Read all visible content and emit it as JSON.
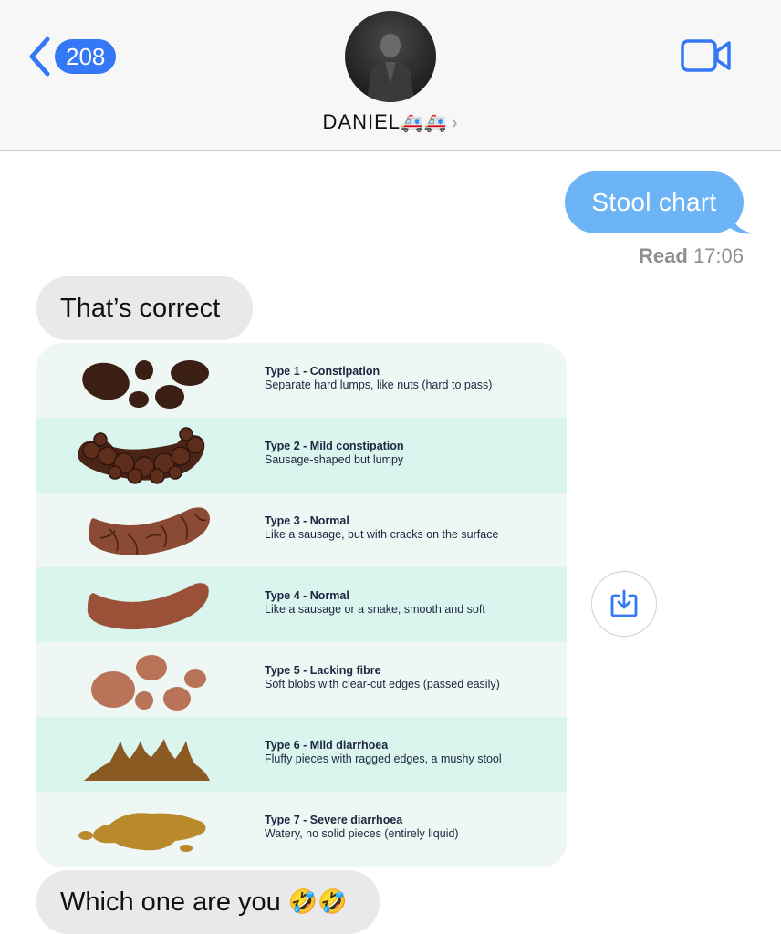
{
  "header": {
    "unread_count": "208",
    "contact_name": "DANIEL",
    "contact_emoji": "🚑🚑",
    "chevron": "›"
  },
  "messages": {
    "outgoing_1": "Stool chart",
    "read_label": "Read",
    "read_time": "17:06",
    "incoming_1": "That’s correct",
    "incoming_2": "Which one are you",
    "incoming_2_emoji": "🤣🤣"
  },
  "stool_chart": {
    "rows": [
      {
        "title": "Type 1 - Constipation",
        "desc": "Separate hard lumps, like nuts (hard to pass)"
      },
      {
        "title": "Type 2 - Mild constipation",
        "desc": "Sausage-shaped but lumpy"
      },
      {
        "title": "Type 3 - Normal",
        "desc": "Like a sausage, but with cracks on the surface"
      },
      {
        "title": "Type 4 - Normal",
        "desc": "Like a sausage or a snake, smooth and soft"
      },
      {
        "title": "Type 5 - Lacking fibre",
        "desc": "Soft blobs with clear-cut edges (passed easily)"
      },
      {
        "title": "Type 6 - Mild diarrhoea",
        "desc": "Fluffy pieces with ragged edges, a mushy stool"
      },
      {
        "title": "Type 7 - Severe diarrhoea",
        "desc": "Watery, no solid pieces (entirely liquid)"
      }
    ]
  },
  "colors": {
    "ios_blue": "#3478f6",
    "outgoing_bubble": "#6cb4f5",
    "incoming_bubble": "#e9e9eb"
  },
  "icons": {
    "back": "chevron-left-icon",
    "video": "video-camera-icon",
    "save": "download-icon"
  }
}
